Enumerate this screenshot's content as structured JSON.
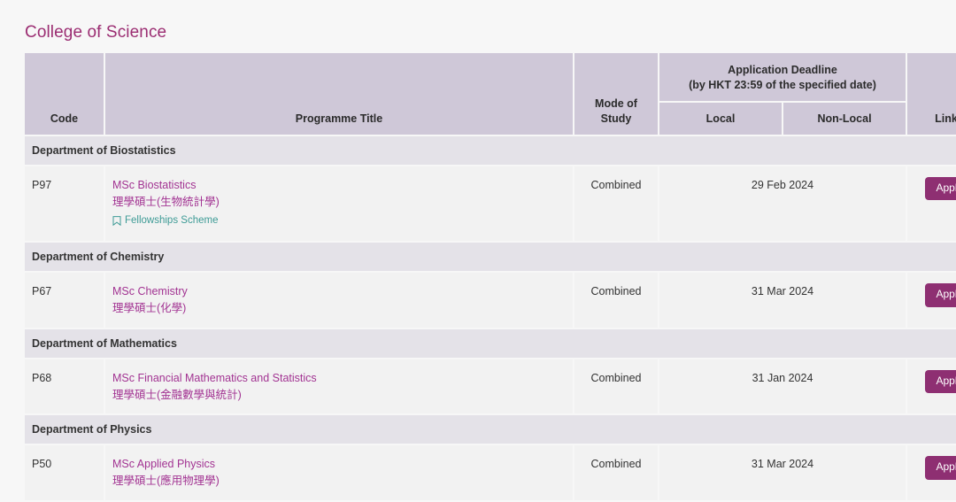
{
  "page": {
    "title": "College of Science",
    "background_color": "#f7f7f7",
    "title_color": "#9B2D72"
  },
  "table": {
    "header": {
      "code": "Code",
      "programme_title": "Programme Title",
      "mode_of_study": "Mode of\nStudy",
      "mode_of_study_line1": "Mode of",
      "mode_of_study_line2": "Study",
      "deadline_group_line1": "Application Deadline",
      "deadline_group_line2": "(by HKT 23:59 of the specified date)",
      "local": "Local",
      "non_local": "Non-Local",
      "links": "Links"
    },
    "colors": {
      "header_bg": "#CFC8D8",
      "dept_bg": "#E4E2E8",
      "row_bg": "#F2F2F2",
      "link": "#A23392",
      "fellowship_link": "#3E9B96",
      "apply_button": "#8E2F72"
    },
    "departments": [
      {
        "name": "Department of Biostatistics",
        "programmes": [
          {
            "code": "P97",
            "title_en": "MSc Biostatistics",
            "title_zh": "理學碩士(生物統計學)",
            "fellowship_label": "Fellowships Scheme",
            "fellowship_icon": "bookmark-icon",
            "mode": "Combined",
            "deadline": "29 Feb 2024",
            "apply_label": "Apply"
          }
        ]
      },
      {
        "name": "Department of Chemistry",
        "programmes": [
          {
            "code": "P67",
            "title_en": "MSc Chemistry",
            "title_zh": "理學碩士(化學)",
            "fellowship_label": null,
            "mode": "Combined",
            "deadline": "31 Mar 2024",
            "apply_label": "Apply"
          }
        ]
      },
      {
        "name": "Department of Mathematics",
        "programmes": [
          {
            "code": "P68",
            "title_en": "MSc Financial Mathematics and Statistics",
            "title_zh": "理學碩士(金融數學與統計)",
            "fellowship_label": null,
            "mode": "Combined",
            "deadline": "31 Jan 2024",
            "apply_label": "Apply"
          }
        ]
      },
      {
        "name": "Department of Physics",
        "programmes": [
          {
            "code": "P50",
            "title_en": "MSc Applied Physics",
            "title_zh": "理學碩士(應用物理學)",
            "fellowship_label": null,
            "mode": "Combined",
            "deadline": "31 Mar 2024",
            "apply_label": "Apply"
          }
        ]
      }
    ]
  }
}
